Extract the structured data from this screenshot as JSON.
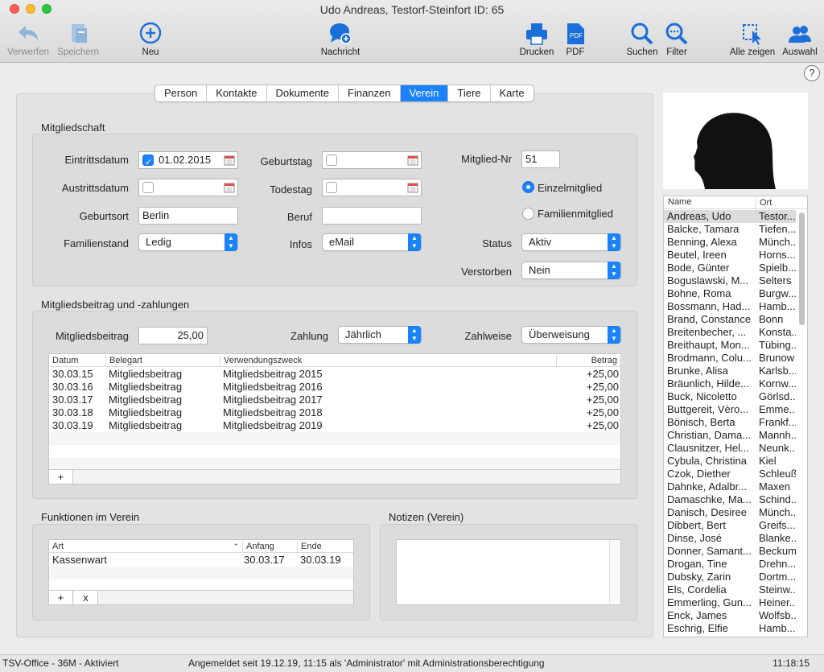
{
  "window": {
    "title": "Udo Andreas, Testorf-Steinfort ID: 65"
  },
  "toolbar": {
    "verwerfen": "Verwerfen",
    "speichern": "Speichern",
    "neu": "Neu",
    "nachricht": "Nachricht",
    "drucken": "Drucken",
    "pdf": "PDF",
    "suchen": "Suchen",
    "filter": "Filter",
    "alle_zeigen": "Alle zeigen",
    "auswahl": "Auswahl"
  },
  "help": "?",
  "tabs": [
    "Person",
    "Kontakte",
    "Dokumente",
    "Finanzen",
    "Verein",
    "Tiere",
    "Karte"
  ],
  "active_tab": "Verein",
  "mitgliedschaft": {
    "title": "Mitgliedschaft",
    "eintrittsdatum_label": "Eintrittsdatum",
    "eintrittsdatum_value": "01.02.2015",
    "austrittsdatum_label": "Austrittsdatum",
    "geburtsort_label": "Geburtsort",
    "geburtsort_value": "Berlin",
    "familienstand_label": "Familienstand",
    "familienstand_value": "Ledig",
    "geburtstag_label": "Geburtstag",
    "todestag_label": "Todestag",
    "beruf_label": "Beruf",
    "beruf_value": "",
    "infos_label": "Infos",
    "infos_value": "eMail",
    "mitglied_nr_label": "Mitglied-Nr",
    "mitglied_nr_value": "51",
    "einzelmitglied": "Einzelmitglied",
    "familienmitglied": "Familienmitglied",
    "status_label": "Status",
    "status_value": "Aktiv",
    "verstorben_label": "Verstorben",
    "verstorben_value": "Nein"
  },
  "beitrag": {
    "title": "Mitgliedsbeitrag und -zahlungen",
    "mitgliedsbeitrag_label": "Mitgliedsbeitrag",
    "mitgliedsbeitrag_value": "25,00",
    "zahlung_label": "Zahlung",
    "zahlung_value": "Jährlich",
    "zahlweise_label": "Zahlweise",
    "zahlweise_value": "Überweisung",
    "columns": {
      "datum": "Datum",
      "belegart": "Belegart",
      "verwendungszweck": "Verwendungszweck",
      "betrag": "Betrag"
    },
    "rows": [
      {
        "datum": "30.03.15",
        "belegart": "Mitgliedsbeitrag",
        "zweck": "Mitgliedsbeitrag 2015",
        "betrag": "+25,00"
      },
      {
        "datum": "30.03.16",
        "belegart": "Mitgliedsbeitrag",
        "zweck": "Mitgliedsbeitrag 2016",
        "betrag": "+25,00"
      },
      {
        "datum": "30.03.17",
        "belegart": "Mitgliedsbeitrag",
        "zweck": "Mitgliedsbeitrag 2017",
        "betrag": "+25,00"
      },
      {
        "datum": "30.03.18",
        "belegart": "Mitgliedsbeitrag",
        "zweck": "Mitgliedsbeitrag 2018",
        "betrag": "+25,00"
      },
      {
        "datum": "30.03.19",
        "belegart": "Mitgliedsbeitrag",
        "zweck": "Mitgliedsbeitrag 2019",
        "betrag": "+25,00"
      }
    ],
    "add": "+"
  },
  "funktionen": {
    "title": "Funktionen im Verein",
    "columns": {
      "art": "Art",
      "anfang": "Anfang",
      "ende": "Ende"
    },
    "rows": [
      {
        "art": "Kassenwart",
        "anfang": "30.03.17",
        "ende": "30.03.19"
      }
    ],
    "add": "+",
    "remove": "x"
  },
  "notizen": {
    "title": "Notizen (Verein)"
  },
  "namelist": {
    "col_name": "Name",
    "col_ort": "Ort",
    "rows": [
      {
        "name": "Andreas, Udo",
        "ort": "Testor..."
      },
      {
        "name": "Balcke, Tamara",
        "ort": "Tiefen..."
      },
      {
        "name": "Benning, Alexa",
        "ort": "Münch..."
      },
      {
        "name": "Beutel, Ireen",
        "ort": "Horns..."
      },
      {
        "name": "Bode, Günter",
        "ort": "Spielb..."
      },
      {
        "name": "Boguslawski, M...",
        "ort": "Selters"
      },
      {
        "name": "Bohne, Roma",
        "ort": "Burgw..."
      },
      {
        "name": "Bossmann, Had...",
        "ort": "Hamb..."
      },
      {
        "name": "Brand, Constance",
        "ort": "Bonn"
      },
      {
        "name": "Breitenbecher, ...",
        "ort": "Konsta..."
      },
      {
        "name": "Breithaupt, Mon...",
        "ort": "Tübing..."
      },
      {
        "name": "Brodmann, Colu...",
        "ort": "Brunow"
      },
      {
        "name": "Brunke, Alisa",
        "ort": "Karlsb..."
      },
      {
        "name": "Bräunlich, Hilde...",
        "ort": "Kornw..."
      },
      {
        "name": "Buck, Nicoletto",
        "ort": "Görlsd..."
      },
      {
        "name": "Buttgereit, Vèro...",
        "ort": "Emme..."
      },
      {
        "name": "Bönisch, Berta",
        "ort": "Frankf..."
      },
      {
        "name": "Christian, Dama...",
        "ort": "Mannh..."
      },
      {
        "name": "Clausnitzer, Hel...",
        "ort": "Neunk..."
      },
      {
        "name": "Cybula, Christina",
        "ort": "Kiel"
      },
      {
        "name": "Czok, Diether",
        "ort": "Schleuß"
      },
      {
        "name": "Dahnke, Adalbr...",
        "ort": "Maxen"
      },
      {
        "name": "Damaschke, Ma...",
        "ort": "Schind..."
      },
      {
        "name": "Danisch, Desiree",
        "ort": "Münch..."
      },
      {
        "name": "Dibbert, Bert",
        "ort": "Greifs..."
      },
      {
        "name": "Dinse, José",
        "ort": "Blanke..."
      },
      {
        "name": "Donner, Samant...",
        "ort": "Beckum"
      },
      {
        "name": "Drogan, Tine",
        "ort": "Drehn..."
      },
      {
        "name": "Dubsky, Zarin",
        "ort": "Dortm..."
      },
      {
        "name": "Els, Cordelia",
        "ort": "Steinw..."
      },
      {
        "name": "Emmerling, Gun...",
        "ort": "Heiner..."
      },
      {
        "name": "Enck, James",
        "ort": "Wolfsb..."
      },
      {
        "name": "Eschrig, Elfie",
        "ort": "Hamb..."
      }
    ]
  },
  "statusbar": {
    "left": "TSV-Office - 36M - Aktiviert",
    "middle": "Angemeldet seit 19.12.19, 11:15 als 'Administrator' mit Administrationsberechtigung",
    "right": "11:18:15"
  },
  "colors": {
    "accent": "#1a82fb"
  }
}
